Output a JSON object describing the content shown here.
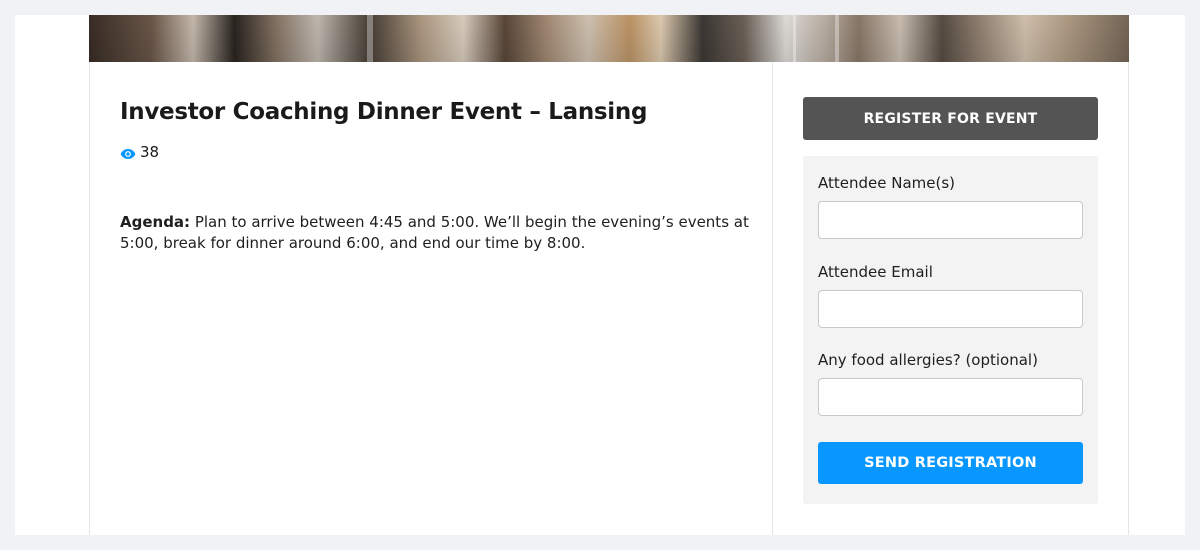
{
  "event": {
    "title": "Investor Coaching Dinner Event – Lansing",
    "view_count": "38",
    "view_icon": "eye-icon",
    "agenda_label": "Agenda:",
    "agenda_text": " Plan to arrive between 4:45 and 5:00. We’ll begin the evening’s events at 5:00, break for dinner around 6:00, and end our time by 8:00."
  },
  "registration": {
    "header": "REGISTER FOR EVENT",
    "fields": [
      {
        "label": "Attendee Name(s)",
        "value": "",
        "placeholder": ""
      },
      {
        "label": "Attendee Email",
        "value": "",
        "placeholder": ""
      },
      {
        "label": "Any food allergies? (optional)",
        "value": "",
        "placeholder": ""
      }
    ],
    "submit_label": "SEND REGISTRATION"
  },
  "colors": {
    "accent": "#0896ff",
    "header_bg": "#545454",
    "form_bg": "#f3f3f3",
    "page_bg": "#f1f2f5"
  }
}
